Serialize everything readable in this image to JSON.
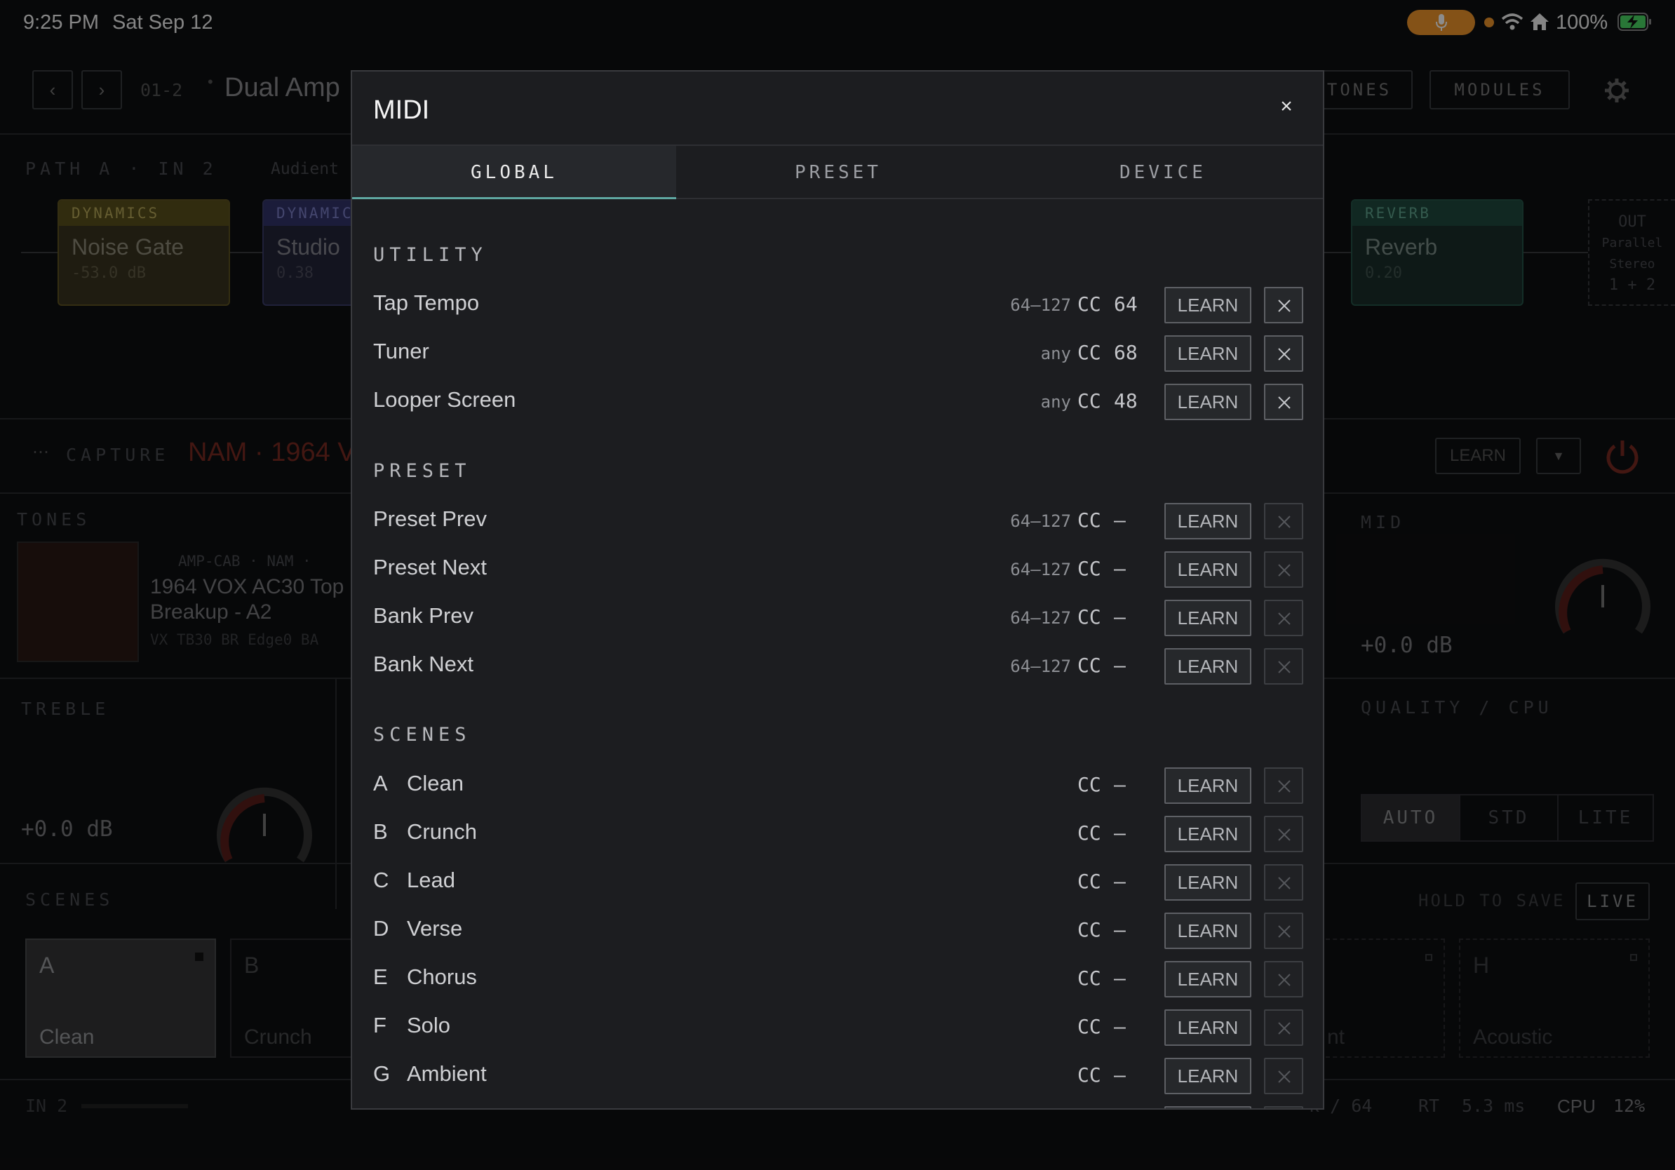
{
  "status": {
    "time": "9:25 PM",
    "date": "Sat Sep 12",
    "battery": "100%"
  },
  "background": {
    "preset_number": "01-2",
    "preset_name": "Dual Amp",
    "tones_btn": "TONES",
    "modules_btn": "MODULES",
    "path_label": "PATH A · IN 2",
    "input_name": "Audient",
    "tiles": [
      {
        "header": "DYNAMICS",
        "name": "Noise Gate",
        "value": "-53.0 dB"
      },
      {
        "header": "DYNAMIC",
        "name": "Studio",
        "value": "0.38"
      },
      {
        "header": "REVERB",
        "name": "Reverb",
        "value": "0.20"
      }
    ],
    "out": [
      "OUT",
      "Parallel",
      "Stereo",
      "1 + 2"
    ],
    "capture_label": "CAPTURE",
    "capture_value": "NAM · 1964 V",
    "capture_learn": "LEARN",
    "tones_label": "TONES",
    "tone_meta": "AMP-CAB · NAM ·",
    "tone_name_1": "1964 VOX AC30 Top",
    "tone_name_2": "Breakup - A2",
    "tone_sub": "VX TB30 BR Edge0 BA",
    "treble_label": "TREBLE",
    "treble_value": "+0.0 dB",
    "mid_label": "MID",
    "mid_value": "+0.0 dB",
    "quality_label": "QUALITY / CPU",
    "quality_options": [
      "AUTO",
      "STD",
      "LITE"
    ],
    "scenes_label": "SCENES",
    "hold_to_save": "HOLD TO SAVE",
    "live_btn": "LIVE",
    "scene_cards": [
      {
        "letter": "A",
        "name": "Clean"
      },
      {
        "letter": "B",
        "name": "Crunch"
      },
      {
        "letter": "",
        "name": "nt"
      },
      {
        "letter": "H",
        "name": "Acoustic"
      }
    ],
    "footer_in": "IN 2",
    "footer_buffer": "k / 64",
    "footer_rt": "RT",
    "footer_rt_val": "5.3 ms",
    "footer_cpu": "CPU",
    "footer_cpu_val": "12%"
  },
  "modal": {
    "title": "MIDI",
    "close": "×",
    "tabs": [
      "GLOBAL",
      "PRESET",
      "DEVICE"
    ],
    "learn_label": "LEARN",
    "cc_label": "CC",
    "sections": {
      "utility": "UTILITY",
      "preset": "PRESET",
      "scenes": "SCENES"
    },
    "utility": [
      {
        "label": "Tap Tempo",
        "range": "64–127",
        "cc": "64"
      },
      {
        "label": "Tuner",
        "range": "any",
        "cc": "68"
      },
      {
        "label": "Looper Screen",
        "range": "any",
        "cc": "48"
      }
    ],
    "preset": [
      {
        "label": "Preset Prev",
        "range": "64–127",
        "cc": "—"
      },
      {
        "label": "Preset Next",
        "range": "64–127",
        "cc": "—"
      },
      {
        "label": "Bank Prev",
        "range": "64–127",
        "cc": "—"
      },
      {
        "label": "Bank Next",
        "range": "64–127",
        "cc": "—"
      }
    ],
    "scenes": [
      {
        "letter": "A",
        "label": "Clean",
        "cc": "—"
      },
      {
        "letter": "B",
        "label": "Crunch",
        "cc": "—"
      },
      {
        "letter": "C",
        "label": "Lead",
        "cc": "—"
      },
      {
        "letter": "D",
        "label": "Verse",
        "cc": "—"
      },
      {
        "letter": "E",
        "label": "Chorus",
        "cc": "—"
      },
      {
        "letter": "F",
        "label": "Solo",
        "cc": "—"
      },
      {
        "letter": "G",
        "label": "Ambient",
        "cc": "—"
      }
    ]
  }
}
